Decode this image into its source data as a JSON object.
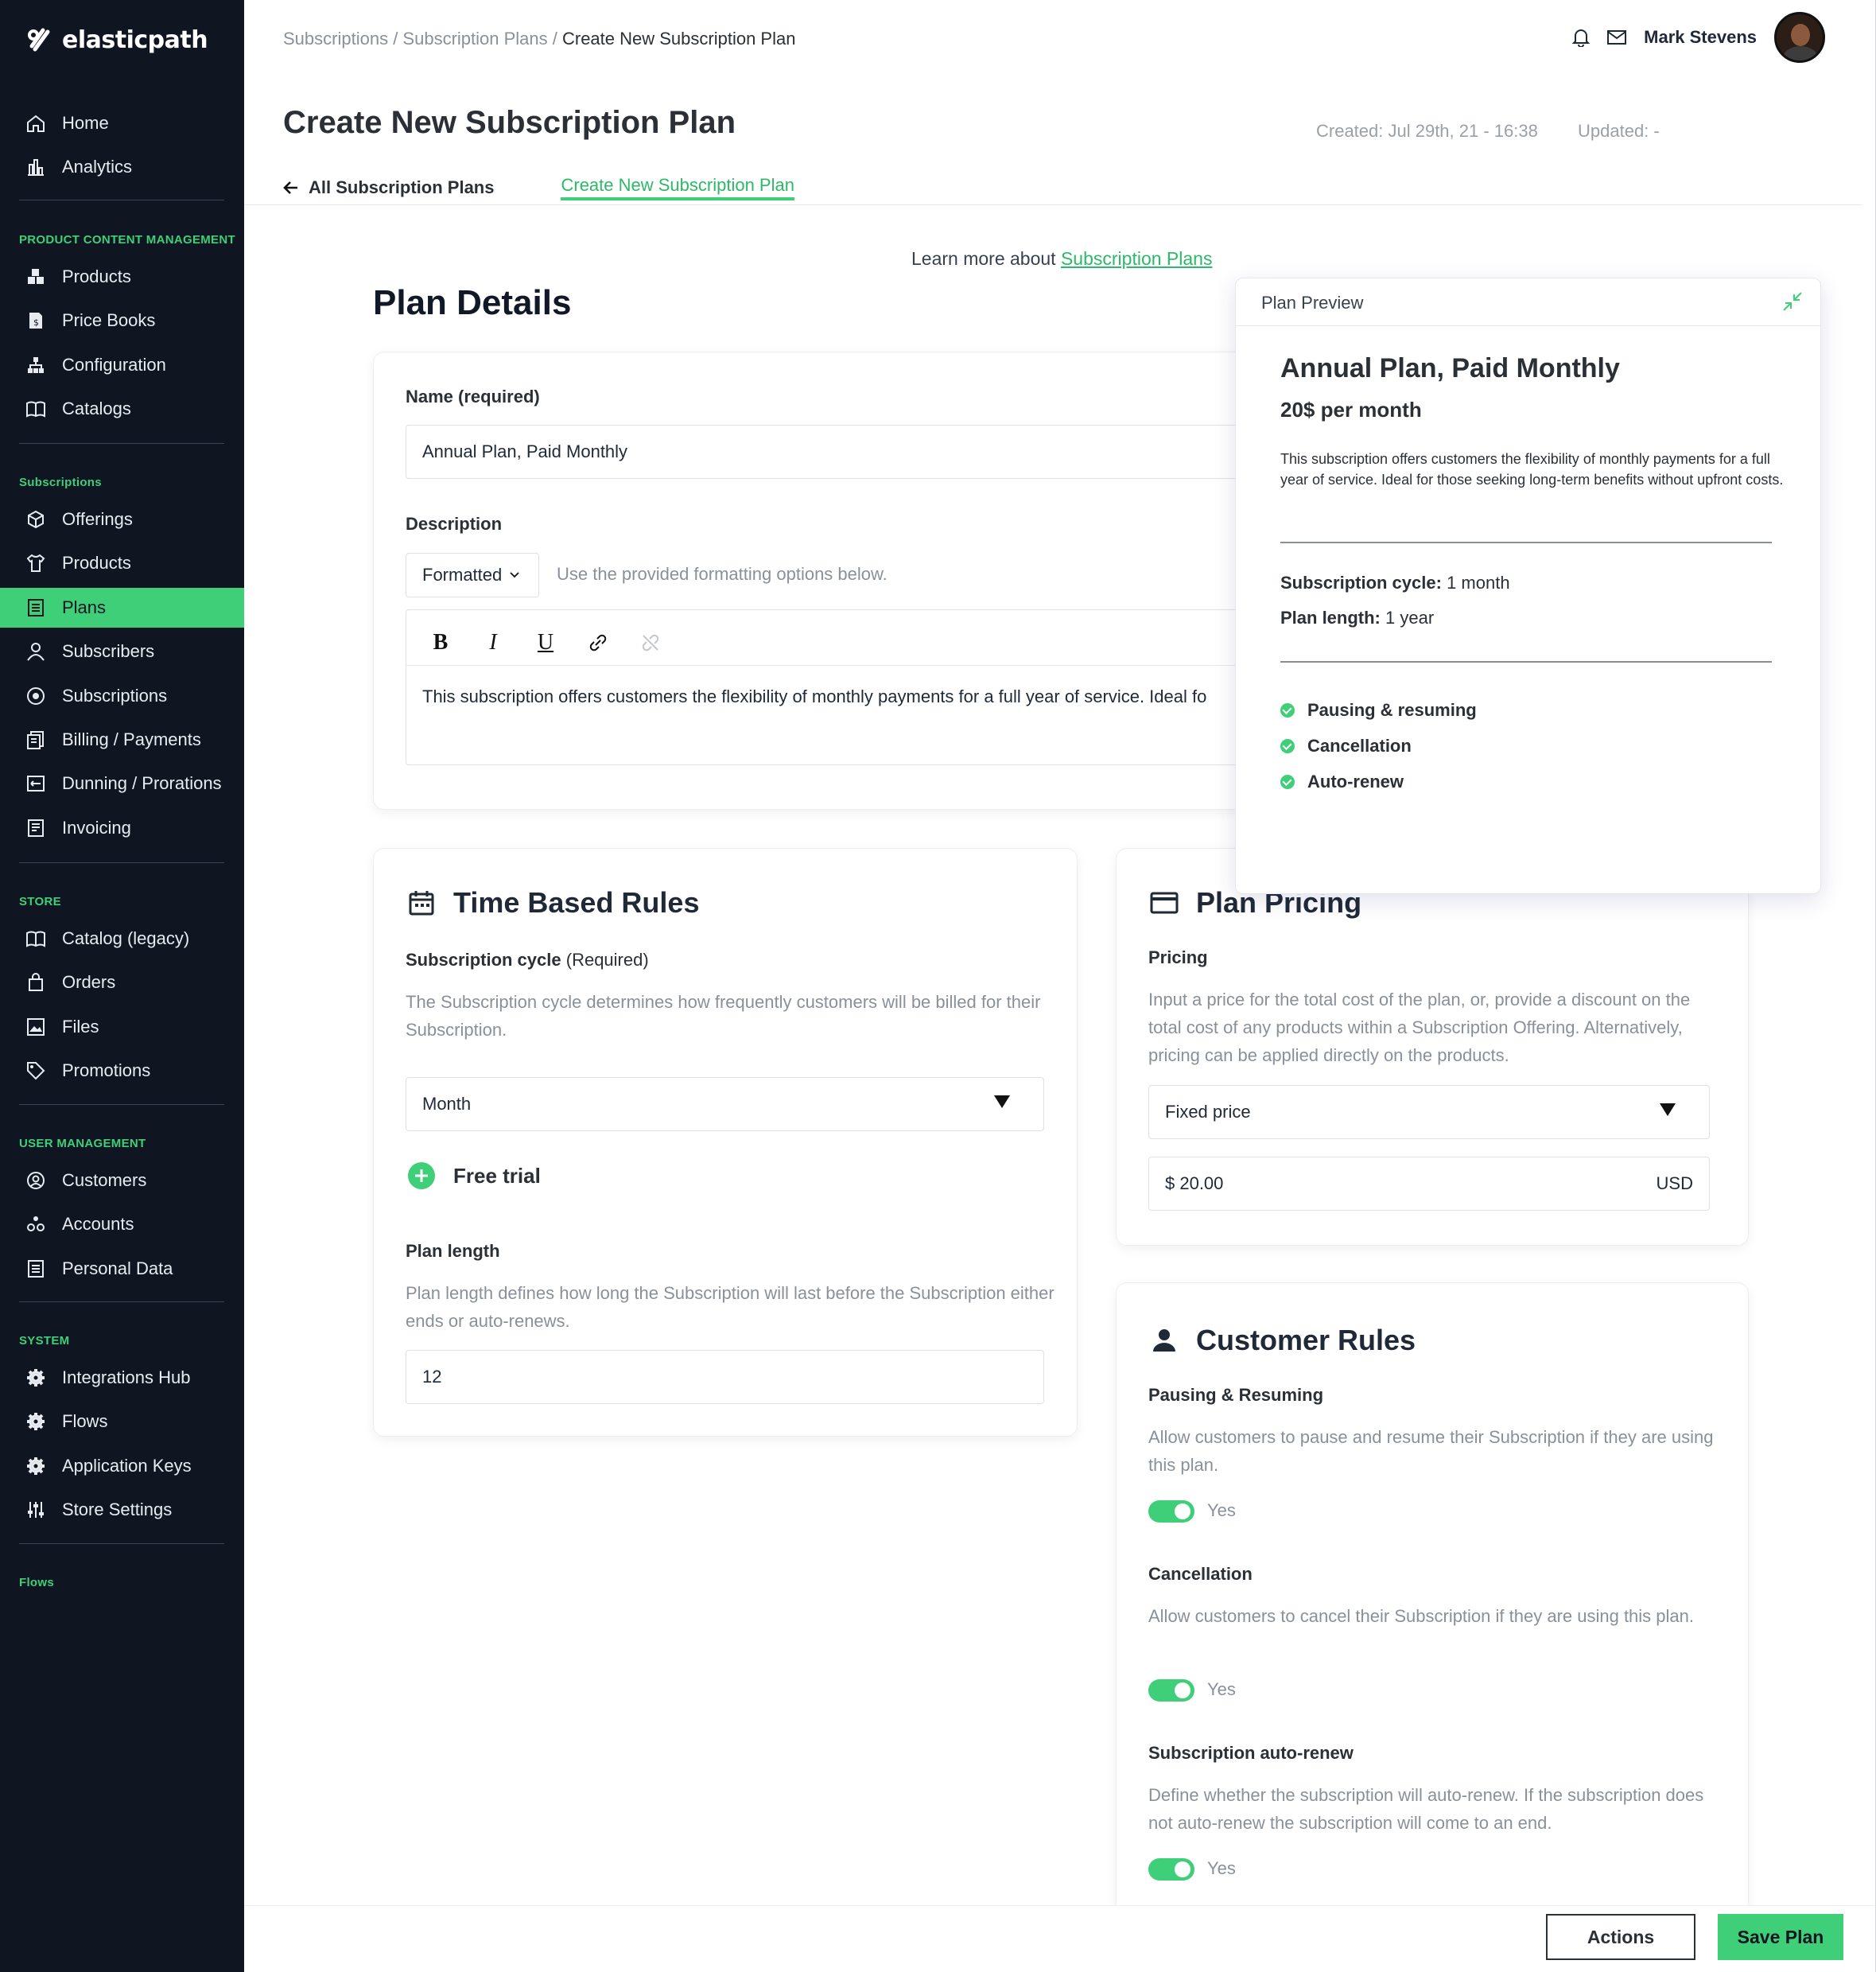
{
  "app": {
    "brand": "elasticpath",
    "accent": "#3ecf78",
    "sidebar_bg": "#0f1521"
  },
  "sidebar": {
    "top": [
      {
        "label": "Home",
        "icon": "home-icon"
      },
      {
        "label": "Analytics",
        "icon": "analytics-icon"
      }
    ],
    "sections": [
      {
        "title": "PRODUCT CONTENT MANAGEMENT",
        "items": [
          {
            "label": "Products",
            "icon": "products-icon"
          },
          {
            "label": "Price Books",
            "icon": "price-books-icon"
          },
          {
            "label": "Configuration",
            "icon": "hierarchy-icon"
          },
          {
            "label": "Catalogs",
            "icon": "book-icon"
          }
        ]
      },
      {
        "title": "Subscriptions",
        "items": [
          {
            "label": "Offerings",
            "icon": "cube-icon"
          },
          {
            "label": "Products",
            "icon": "shirt-icon"
          },
          {
            "label": "Plans",
            "icon": "list-icon"
          },
          {
            "label": "Subscribers",
            "icon": "person-icon"
          },
          {
            "label": "Subscriptions",
            "icon": "cycle-icon"
          },
          {
            "label": "Billing / Payments",
            "icon": "billing-icon"
          },
          {
            "label": "Dunning / Prorations",
            "icon": "dunning-icon"
          },
          {
            "label": "Invoicing",
            "icon": "invoice-icon"
          }
        ]
      },
      {
        "title": "STORE",
        "items": [
          {
            "label": "Catalog (legacy)",
            "icon": "book-icon"
          },
          {
            "label": "Orders",
            "icon": "bag-icon"
          },
          {
            "label": "Files",
            "icon": "image-icon"
          },
          {
            "label": "Promotions",
            "icon": "tag-icon"
          }
        ]
      },
      {
        "title": "USER MANAGEMENT",
        "items": [
          {
            "label": "Customers",
            "icon": "user-circle-icon"
          },
          {
            "label": "Accounts",
            "icon": "accounts-icon"
          },
          {
            "label": "Personal Data",
            "icon": "list-icon"
          }
        ]
      },
      {
        "title": "SYSTEM",
        "items": [
          {
            "label": "Integrations Hub",
            "icon": "gear-icon"
          },
          {
            "label": "Flows",
            "icon": "gear-icon"
          },
          {
            "label": "Application Keys",
            "icon": "gear-icon"
          },
          {
            "label": "Store Settings",
            "icon": "sliders-icon"
          }
        ]
      },
      {
        "title": "Flows",
        "items": []
      }
    ]
  },
  "header": {
    "breadcrumb": [
      "Subscriptions",
      "Subscription Plans",
      "Create New Subscription Plan"
    ],
    "user_name": "Mark Stevens",
    "title": "Create New Subscription Plan",
    "created": "Created: Jul 29th, 21 - 16:38",
    "updated": "Updated: -",
    "tab_back": "All Subscription Plans",
    "tab_active": "Create New Subscription Plan"
  },
  "learn": {
    "prefix": "Learn more about ",
    "link": "Subscription Plans"
  },
  "plan_details": {
    "heading": "Plan Details",
    "name_label": "Name",
    "name_req": "(required)",
    "name_value": "Annual Plan, Paid Monthly",
    "desc_label": "Description",
    "format_value": "Formatted",
    "format_help": "Use the provided formatting options below.",
    "desc_value": "This subscription offers customers the flexibility of monthly payments for a full year of service. Ideal fo"
  },
  "time_rules": {
    "title": "Time Based Rules",
    "cycle_label": "Subscription cycle",
    "cycle_req": "(Required)",
    "cycle_help": "The Subscription cycle determines how frequently customers will be billed for their Subscription.",
    "cycle_value": "Month",
    "free_trial": "Free trial",
    "length_label": "Plan length",
    "length_help": "Plan length defines how long the Subscription will last before the Subscription either ends or auto-renews.",
    "length_value": "12"
  },
  "pricing": {
    "title": "Plan Pricing",
    "label": "Pricing",
    "help": "Input a price for the total cost of the plan, or, provide a discount on the total cost of any products within a Subscription Offering. Alternatively, pricing can be applied directly on the products.",
    "type_value": "Fixed price",
    "price_value": "$ 20.00",
    "currency": "USD"
  },
  "customer_rules": {
    "title": "Customer Rules",
    "pause_label": "Pausing & Resuming",
    "pause_help": "Allow customers to pause and resume their Subscription if they are using this plan.",
    "pause_value": "Yes",
    "cancel_label": "Cancellation",
    "cancel_help": "Allow customers to cancel their Subscription if they are using this plan.",
    "cancel_value": "Yes",
    "renew_label": "Subscription auto-renew",
    "renew_help": "Define whether the subscription will auto-renew. If the subscription does not auto-renew the subscription will come to an end.",
    "renew_value": "Yes"
  },
  "preview": {
    "title": "Plan Preview",
    "name": "Annual Plan, Paid Monthly",
    "price": "20$ per month",
    "desc": "This subscription offers customers the flexibility of monthly payments for a full year of service. Ideal for those seeking long-term benefits without upfront costs.",
    "cycle_key": "Subscription cycle:",
    "cycle_val": " 1 month",
    "length_key": "Plan length:",
    "length_val": " 1 year",
    "features": [
      "Pausing & resuming",
      "Cancellation",
      "Auto-renew"
    ]
  },
  "footer": {
    "actions": "Actions",
    "save": "Save Plan"
  }
}
